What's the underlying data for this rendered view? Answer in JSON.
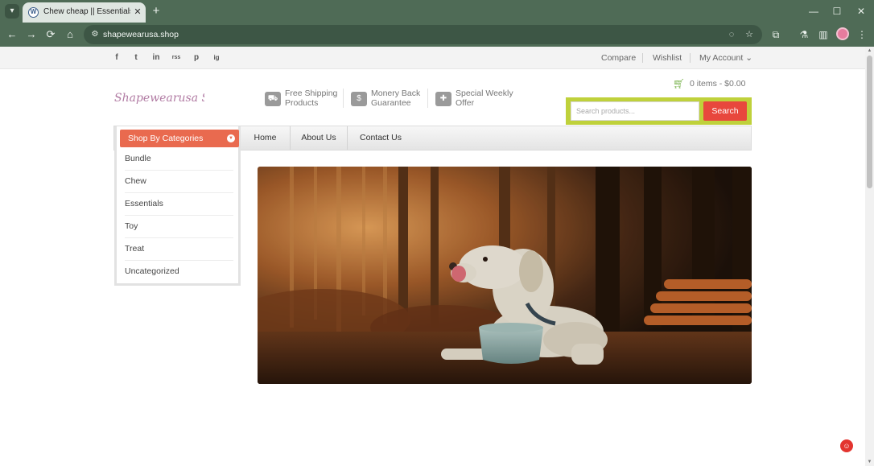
{
  "browser": {
    "tab_title": "Chew cheap || Essentials sale || Shapewearusa Shop",
    "tab_favicon": "W",
    "url": "shapewearusa.shop",
    "icons": {
      "tab_menu": "▾",
      "tab_close": "✕",
      "new_tab": "+",
      "back": "←",
      "forward": "→",
      "reload": "⟳",
      "home": "⌂",
      "site_info": "⚙",
      "eye_off": "◌",
      "star": "☆",
      "extensions": "⧉",
      "labs": "⚗",
      "sidebar": "▥",
      "menu": "⋮",
      "minimize": "—",
      "maximize": "☐",
      "close": "✕"
    }
  },
  "topbar": {
    "social": [
      "f",
      "t",
      "in",
      "rss",
      "p",
      "ig"
    ],
    "compare": "Compare",
    "wishlist": "Wishlist",
    "account": "My Account ⌄"
  },
  "header": {
    "logo": "Shapewearusa Shop",
    "features": [
      {
        "line1": "Free Shipping",
        "line2": "Products",
        "icon": "truck-icon"
      },
      {
        "line1": "Monery Back",
        "line2": "Guarantee",
        "icon": "money-icon"
      },
      {
        "line1": "Special Weekly",
        "line2": "Offer",
        "icon": "gift-icon"
      }
    ],
    "cart": "0 items -  $0.00",
    "search": {
      "placeholder": "Search products...",
      "button": "Search"
    }
  },
  "nav": {
    "categories_label": "Shop By Categories",
    "items": [
      "Home",
      "About Us",
      "Contact Us"
    ]
  },
  "categories": [
    "Bundle",
    "Chew",
    "Essentials",
    "Toy",
    "Treat",
    "Uncategorized"
  ],
  "colors": {
    "browser_frame": "#4f6b56",
    "accent_red": "#e8473d",
    "category_head": "#e96a4f",
    "search_frame": "#bfd13b"
  }
}
